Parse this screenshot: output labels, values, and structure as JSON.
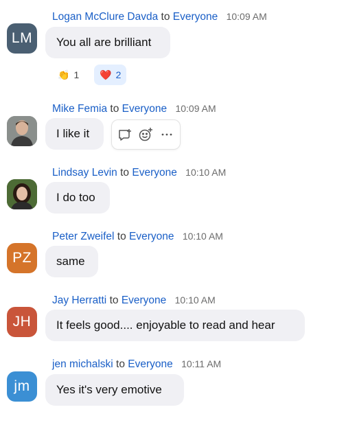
{
  "messages": [
    {
      "sender": "Logan McClure Davda",
      "to_word": "to",
      "recipient": "Everyone",
      "time": "10:09 AM",
      "text": "You all are brilliant",
      "avatar_initials": "LM",
      "avatar_color": "#4a5f72"
    },
    {
      "sender": "Mike Femia",
      "to_word": "to",
      "recipient": "Everyone",
      "time": "10:09 AM",
      "text": "I like it",
      "avatar_initials": "",
      "avatar_color": "#7a7f82"
    },
    {
      "sender": "Lindsay Levin",
      "to_word": "to",
      "recipient": "Everyone",
      "time": "10:10 AM",
      "text": "I do too",
      "avatar_initials": "",
      "avatar_color": "#3c5a2a"
    },
    {
      "sender": "Peter Zweifel",
      "to_word": "to",
      "recipient": "Everyone",
      "time": "10:10 AM",
      "text": "same",
      "avatar_initials": "PZ",
      "avatar_color": "#d5742a"
    },
    {
      "sender": "Jay Herratti",
      "to_word": "to",
      "recipient": "Everyone",
      "time": "10:10 AM",
      "text": "It feels good.... enjoyable to read and hear",
      "avatar_initials": "JH",
      "avatar_color": "#c9553a"
    },
    {
      "sender": "jen michalski",
      "to_word": "to",
      "recipient": "Everyone",
      "time": "10:11 AM",
      "text": "Yes it's very emotive",
      "avatar_initials": "jm",
      "avatar_color": "#3b8fd4"
    }
  ],
  "reactions": [
    {
      "emoji": "👏",
      "count": "1",
      "selected": false
    },
    {
      "emoji": "❤️",
      "count": "2",
      "selected": true
    }
  ],
  "toolbar_icons": [
    "reply-icon",
    "add-reaction-icon",
    "more-icon"
  ],
  "colors": {
    "link": "#1a5fc7",
    "bubble": "#f0f0f4",
    "reaction_active": "#e4efff"
  }
}
